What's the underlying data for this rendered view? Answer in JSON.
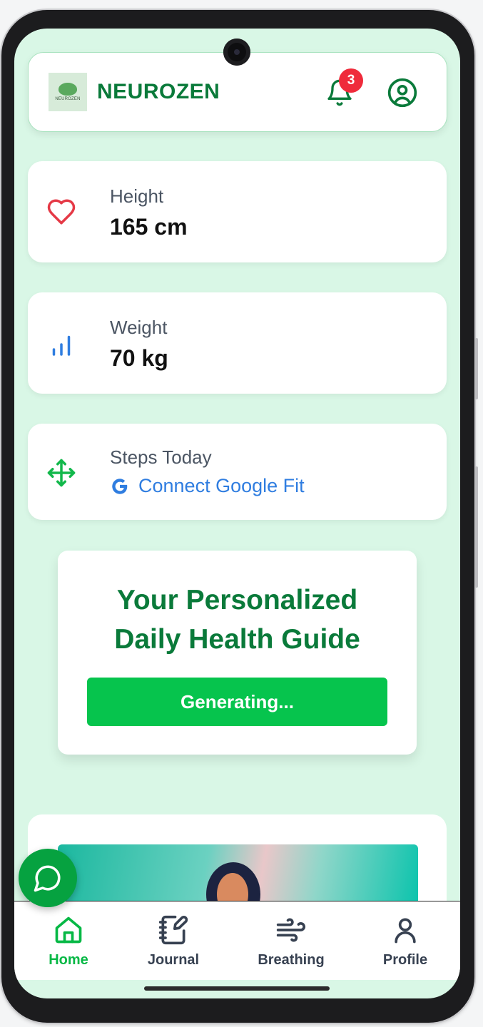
{
  "header": {
    "logo_text": "NEUROZEN",
    "title": "NEUROZEN",
    "notification_count": "3",
    "icons": [
      "bell-icon",
      "account-icon"
    ]
  },
  "stats": [
    {
      "label": "Height",
      "value": "165 cm",
      "icon": "heart-icon",
      "color": "#e53946"
    },
    {
      "label": "Weight",
      "value": "70 kg",
      "icon": "bar-chart-icon",
      "color": "#2f7de0"
    },
    {
      "label": "Steps Today",
      "action": "Connect Google Fit",
      "icon": "move-icon",
      "color": "#12b84b"
    }
  ],
  "guide": {
    "title_line1": "Your Personalized",
    "title_line2": "Daily Health Guide",
    "button_label": "Generating..."
  },
  "tabs": [
    {
      "label": "Home",
      "icon": "home-icon",
      "active": true
    },
    {
      "label": "Journal",
      "icon": "journal-icon",
      "active": false
    },
    {
      "label": "Breathing",
      "icon": "wind-icon",
      "active": false
    },
    {
      "label": "Profile",
      "icon": "user-icon",
      "active": false
    }
  ],
  "colors": {
    "brand_green": "#0a7a3a",
    "accent_green": "#06c44d",
    "background": "#d9f7e6",
    "badge_red": "#ef2b3b",
    "link_blue": "#2f7de0"
  }
}
